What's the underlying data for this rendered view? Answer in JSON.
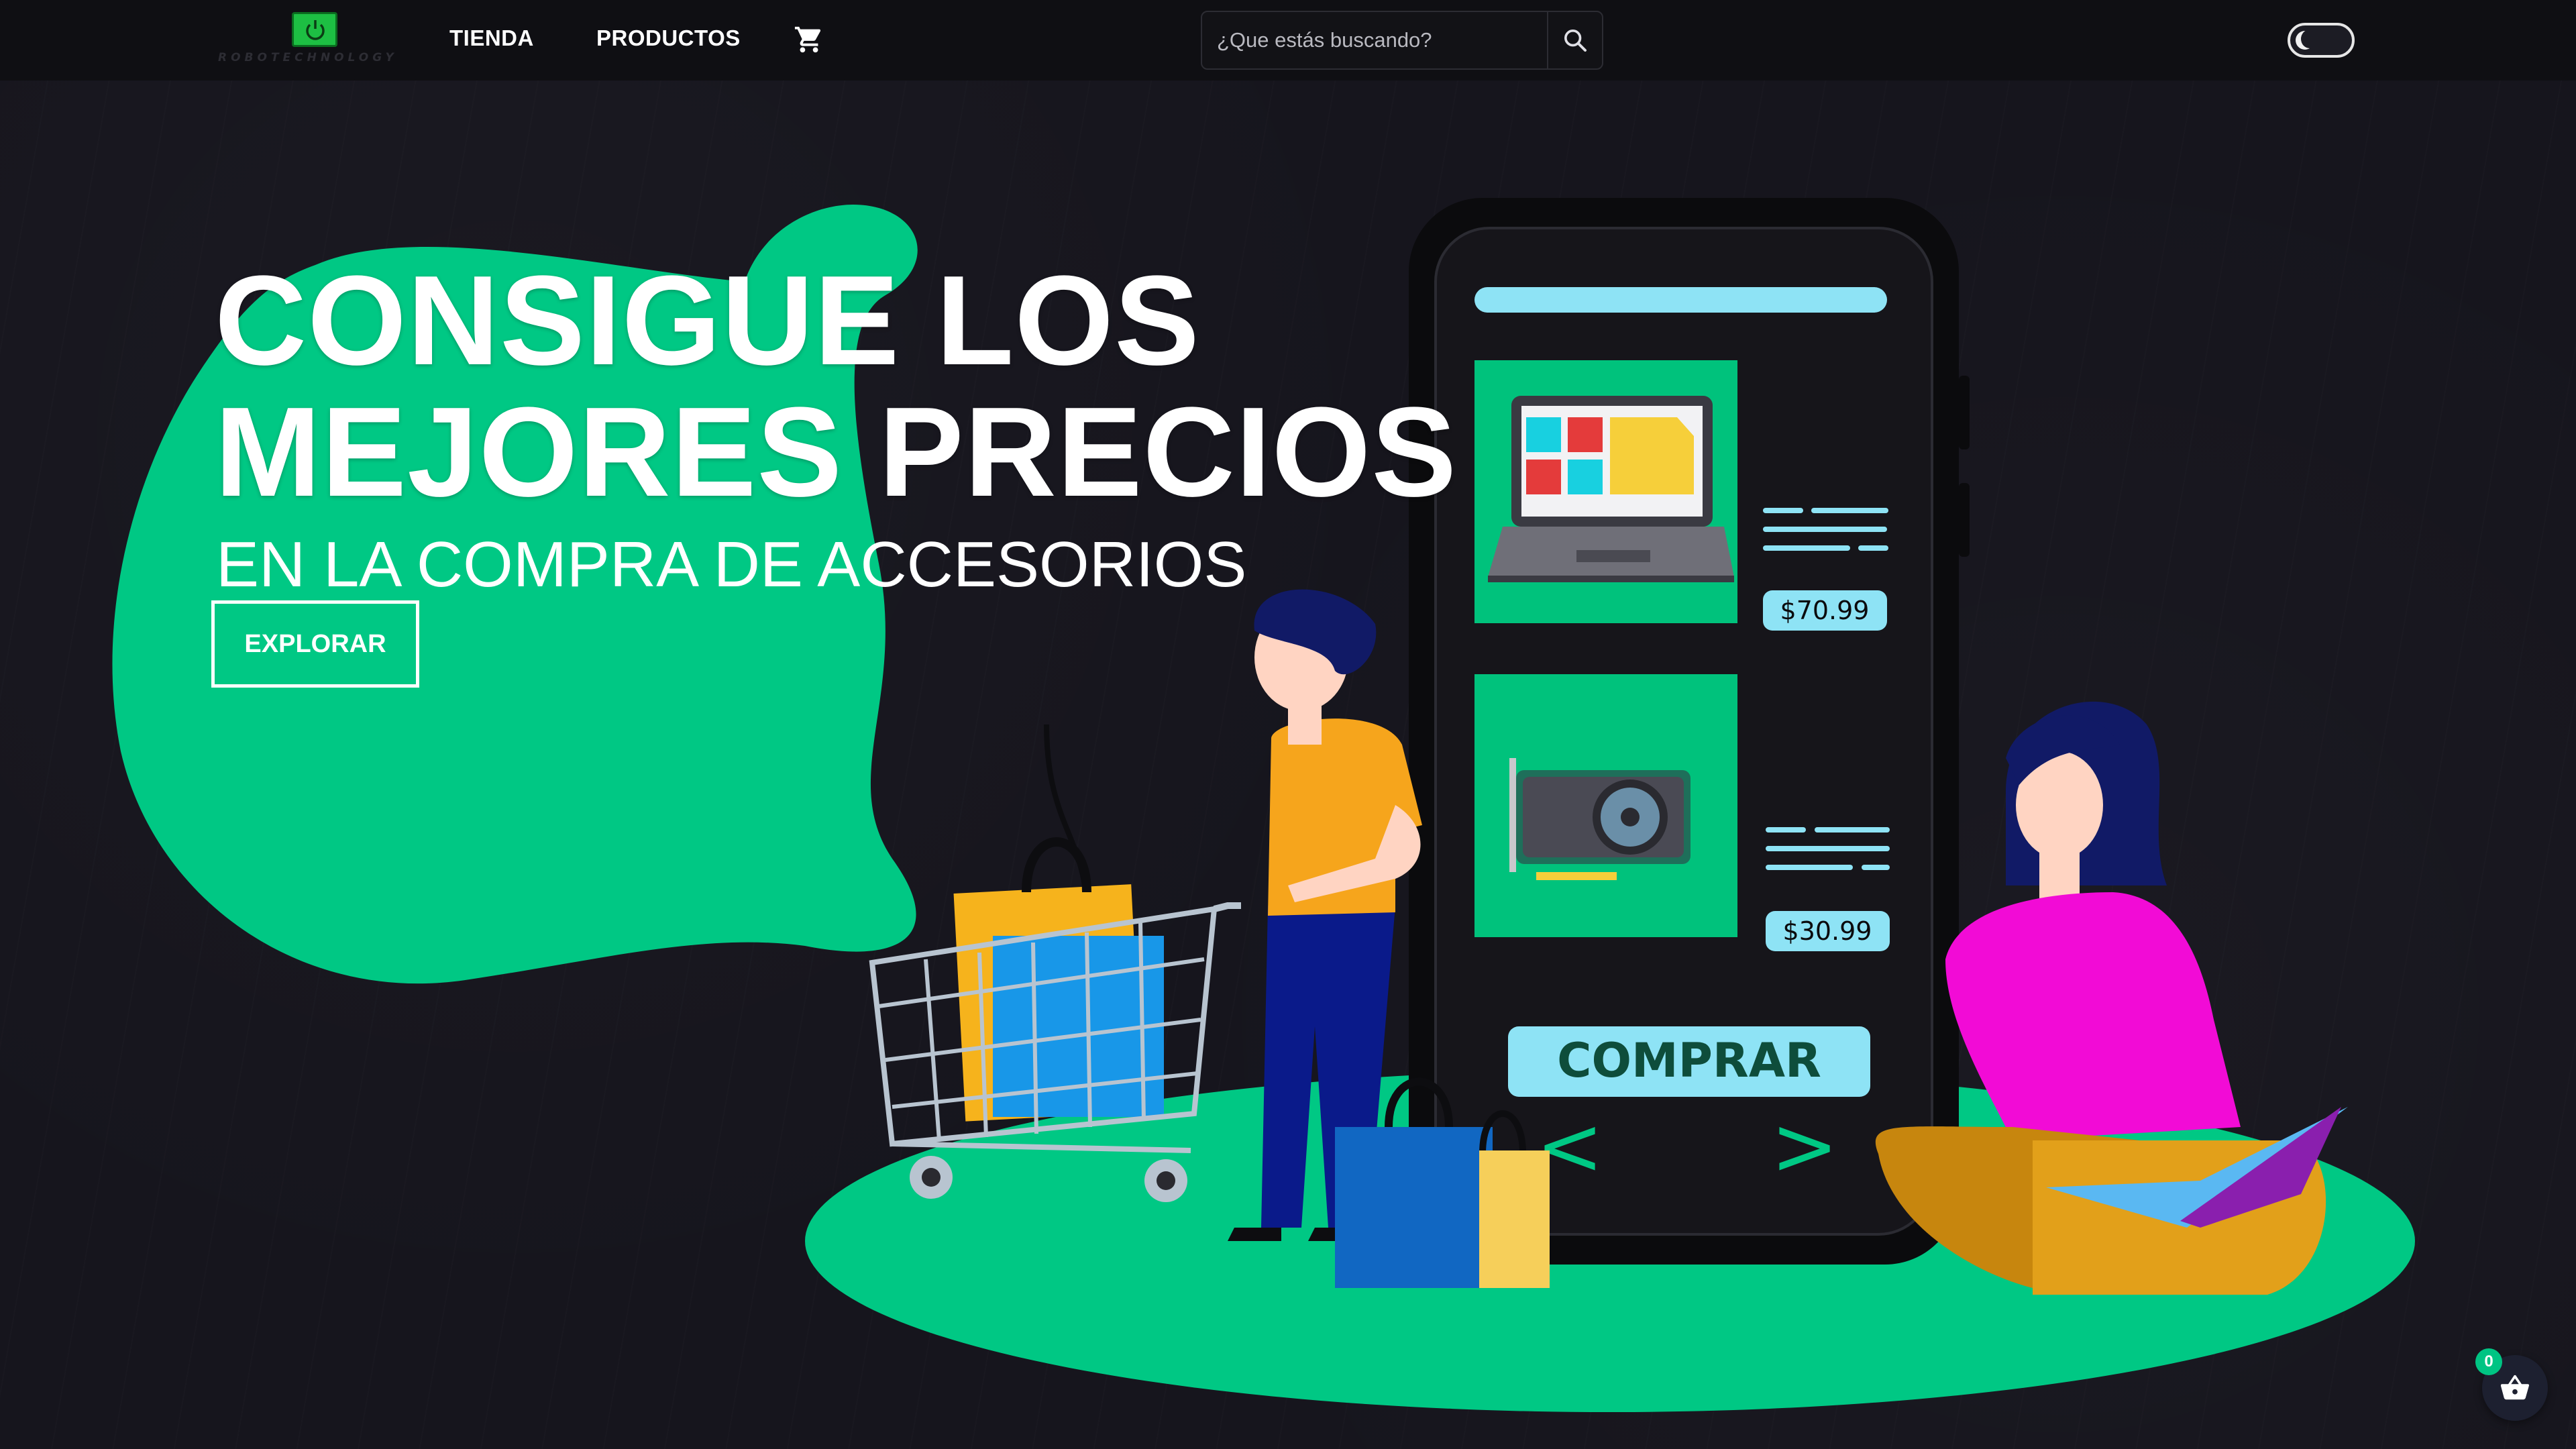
{
  "navbar": {
    "logo_text": "ROBOTECHNOLOGY",
    "links": [
      {
        "label": "TIENDA"
      },
      {
        "label": "PRODUCTOS"
      }
    ],
    "cart_icon": "cart-icon",
    "search": {
      "placeholder": "¿Que estás buscando?",
      "icon": "search-icon"
    },
    "theme_toggle": "dark-mode-toggle"
  },
  "hero": {
    "title_line1": "CONSIGUE LOS",
    "title_line2": "MEJORES PRECIOS",
    "subtitle": "EN LA COMPRA DE ACCESORIOS",
    "cta_label": "EXPLORAR"
  },
  "illustration": {
    "price_laptop": "$70.99",
    "price_gpu": "$30.99",
    "buy_label": "COMPRAR",
    "prev_glyph": "<",
    "next_glyph": ">"
  },
  "floating_cart": {
    "count": "0",
    "icon": "basket-icon"
  },
  "colors": {
    "background": "#16151d",
    "navbar": "#0f0f13",
    "accent_green": "#00c884",
    "phone_card_green": "#00c27c",
    "light_blue": "#8ee3f5",
    "text": "#ffffff"
  }
}
